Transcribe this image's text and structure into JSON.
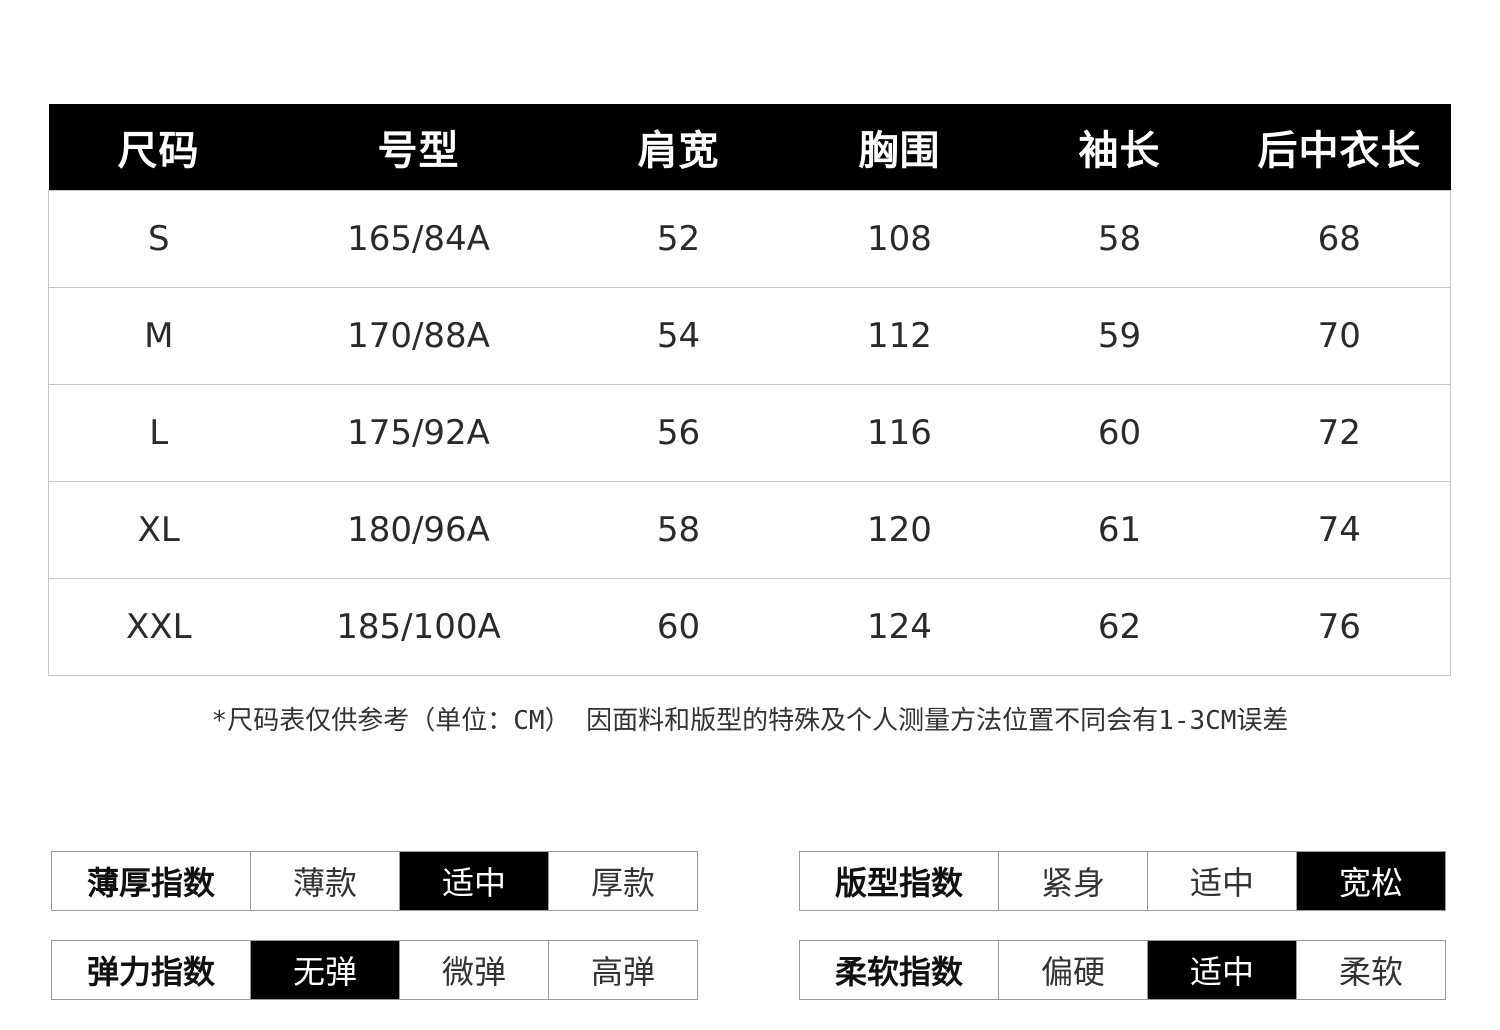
{
  "size_table": {
    "headers": [
      "尺码",
      "号型",
      "肩宽",
      "胸围",
      "袖长",
      "后中衣长"
    ],
    "rows": [
      [
        "S",
        "165/84A",
        "52",
        "108",
        "58",
        "68"
      ],
      [
        "M",
        "170/88A",
        "54",
        "112",
        "59",
        "70"
      ],
      [
        "L",
        "175/92A",
        "56",
        "116",
        "60",
        "72"
      ],
      [
        "XL",
        "180/96A",
        "58",
        "120",
        "61",
        "74"
      ],
      [
        "XXL",
        "185/100A",
        "60",
        "124",
        "62",
        "76"
      ]
    ]
  },
  "note": "*尺码表仅供参考（单位：CM） 因面料和版型的特殊及个人测量方法位置不同会有1-3CM误差",
  "indices": {
    "thickness": {
      "label": "薄厚指数",
      "options": [
        "薄款",
        "适中",
        "厚款"
      ],
      "selected": "适中"
    },
    "fit": {
      "label": "版型指数",
      "options": [
        "紧身",
        "适中",
        "宽松"
      ],
      "selected": "宽松"
    },
    "elasticity": {
      "label": "弹力指数",
      "options": [
        "无弹",
        "微弹",
        "高弹"
      ],
      "selected": "无弹"
    },
    "softness": {
      "label": "柔软指数",
      "options": [
        "偏硬",
        "适中",
        "柔软"
      ],
      "selected": "适中"
    }
  }
}
